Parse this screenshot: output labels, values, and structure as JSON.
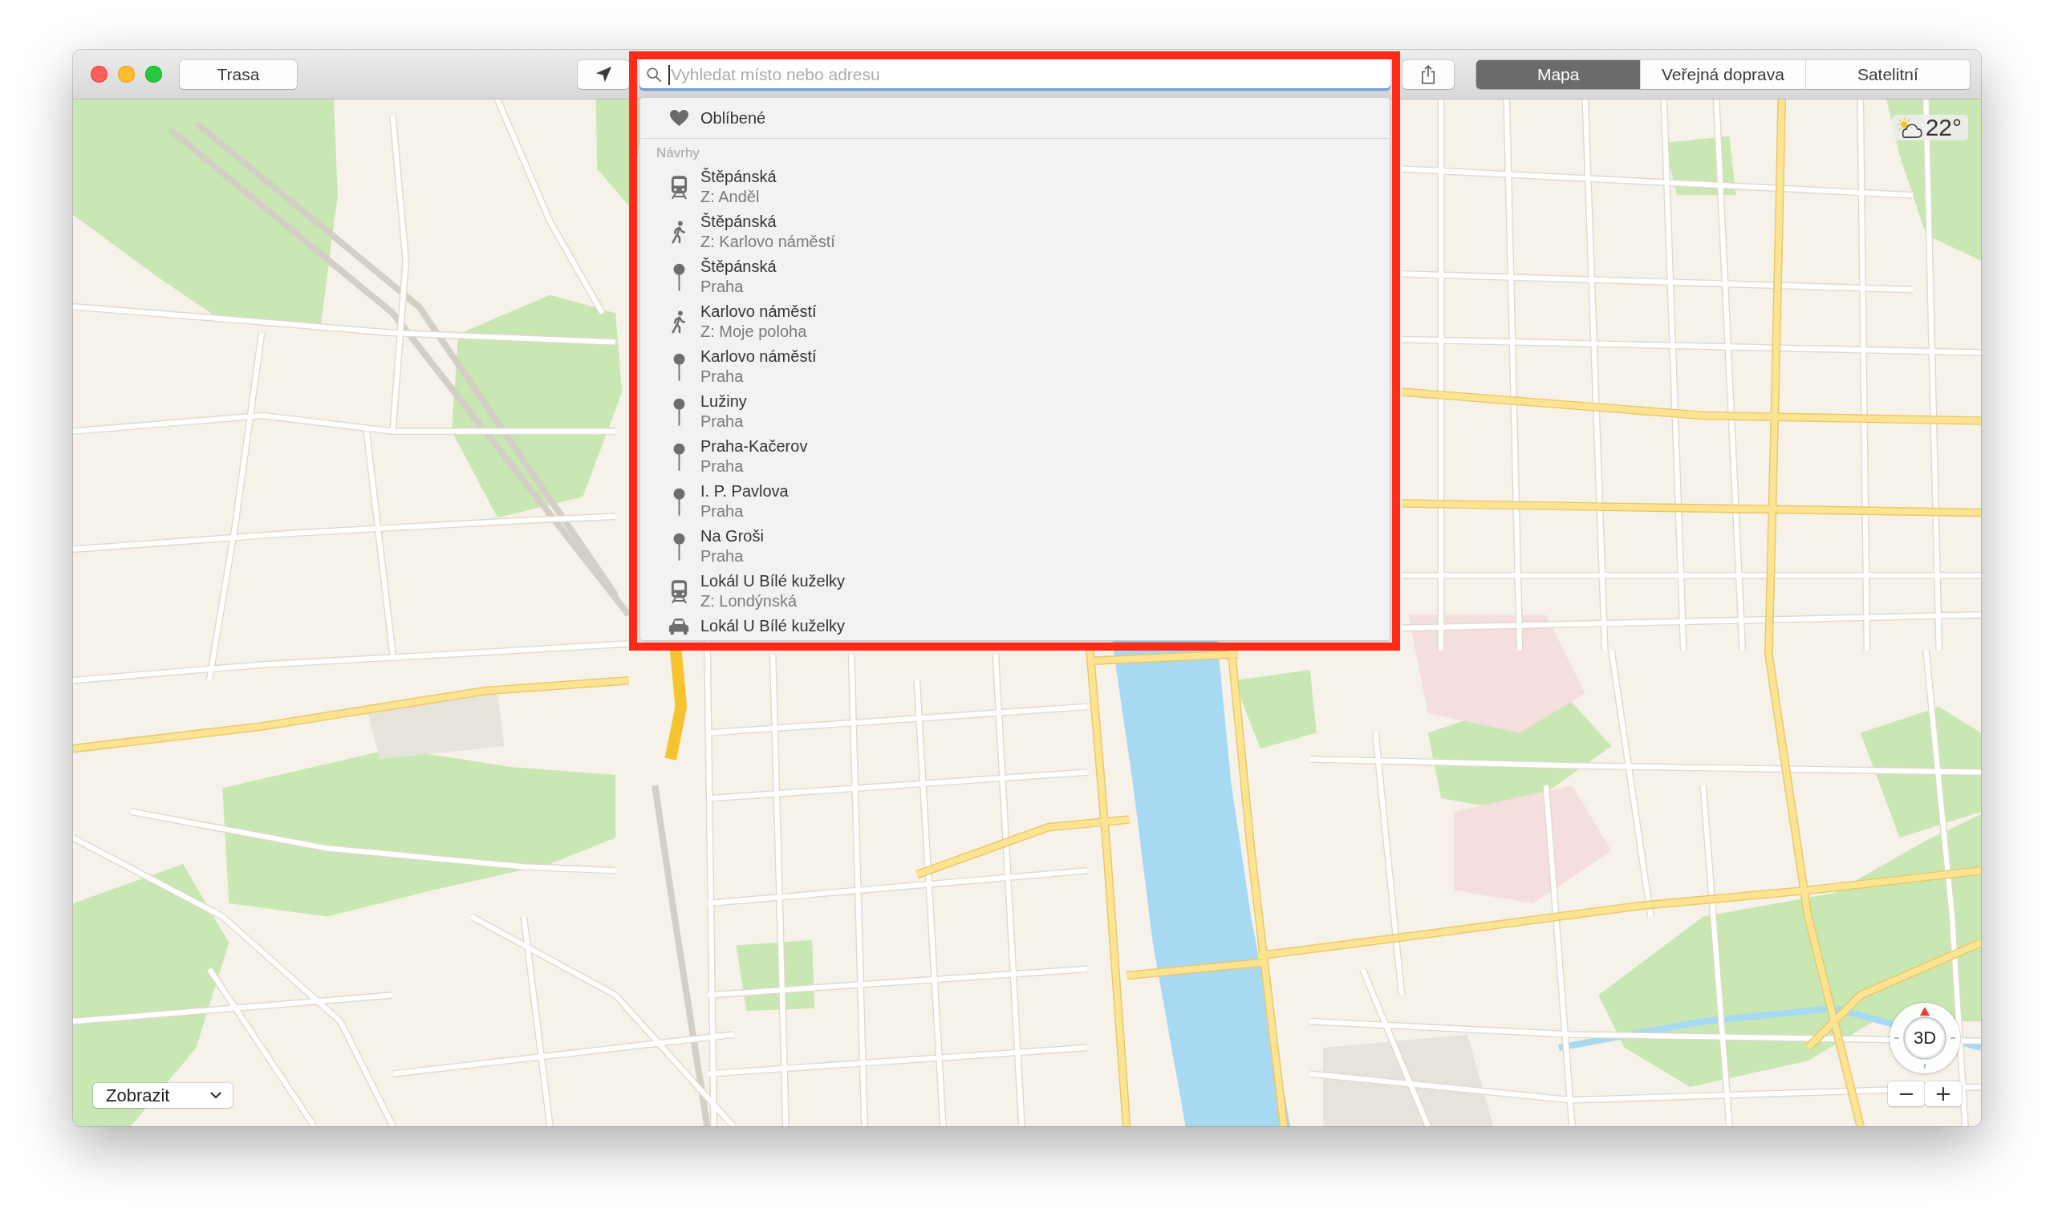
{
  "toolbar": {
    "route_button": "Trasa",
    "search": {
      "placeholder": "Vyhledat místo nebo adresu",
      "focused": true
    },
    "view_tabs": [
      {
        "label": "Mapa",
        "selected": true
      },
      {
        "label": "Veřejná doprava",
        "selected": false
      },
      {
        "label": "Satelitní",
        "selected": false
      }
    ]
  },
  "search_dropdown": {
    "highlighted": true,
    "favorites": {
      "label": "Oblíbené"
    },
    "section_title": "Návrhy",
    "suggestions": [
      {
        "kind": "transit",
        "title": "Štěpánská",
        "subtitle": "Z: Anděl"
      },
      {
        "kind": "walk",
        "title": "Štěpánská",
        "subtitle": "Z: Karlovo náměstí"
      },
      {
        "kind": "pin",
        "title": "Štěpánská",
        "subtitle": "Praha"
      },
      {
        "kind": "walk",
        "title": "Karlovo náměstí",
        "subtitle": "Z: Moje poloha"
      },
      {
        "kind": "pin",
        "title": "Karlovo náměstí",
        "subtitle": "Praha"
      },
      {
        "kind": "pin",
        "title": "Lužiny",
        "subtitle": "Praha"
      },
      {
        "kind": "pin",
        "title": "Praha-Kačerov",
        "subtitle": "Praha"
      },
      {
        "kind": "pin",
        "title": "I. P. Pavlova",
        "subtitle": "Praha"
      },
      {
        "kind": "pin",
        "title": "Na Groši",
        "subtitle": "Praha"
      },
      {
        "kind": "transit",
        "title": "Lokál U Bílé kuželky",
        "subtitle": "Z: Londýnská"
      },
      {
        "kind": "car",
        "title": "Lokál U Bílé kuželky"
      }
    ]
  },
  "map": {
    "weather": {
      "temperature": "22°"
    },
    "compass": {
      "label": "3D"
    },
    "zoom_buttons": [
      "−",
      "+"
    ],
    "display_menu": {
      "label": "Zobrazit"
    }
  }
}
